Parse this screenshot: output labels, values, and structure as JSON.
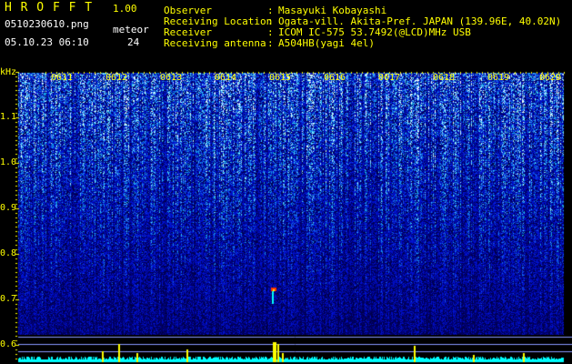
{
  "app": {
    "name": "H R O F F T",
    "version": "1.00",
    "filename": "0510230610.png",
    "datetime": "05.10.23 06:10",
    "meteor_label": "meteor",
    "meteor_count": "24"
  },
  "info": [
    {
      "label": "Observer",
      "value": "Masayuki Kobayashi"
    },
    {
      "label": "Receiving Location",
      "value": "Ogata-vill. Akita-Pref. JAPAN (139.96E, 40.02N)"
    },
    {
      "label": "Receiver",
      "value": "ICOM IC-575 53.7492(@LCD)MHz USB"
    },
    {
      "label": "Receiving antenna",
      "value": "A504HB(yagi 4el)"
    }
  ],
  "separator": ":",
  "spectrogram": {
    "y_unit": "kHz",
    "time_ticks": [
      "0611",
      "0612",
      "0613",
      "0614",
      "0615",
      "0616",
      "0617",
      "0618",
      "0619",
      "0620"
    ],
    "freq_ticks": [
      "1.1",
      "1.0",
      "0.9",
      "0.8",
      "0.7",
      "0.6"
    ],
    "colors": {
      "text": "#ffff00",
      "background": "#000000",
      "signal": "#ff3300",
      "trace": "#00ffff"
    }
  }
}
